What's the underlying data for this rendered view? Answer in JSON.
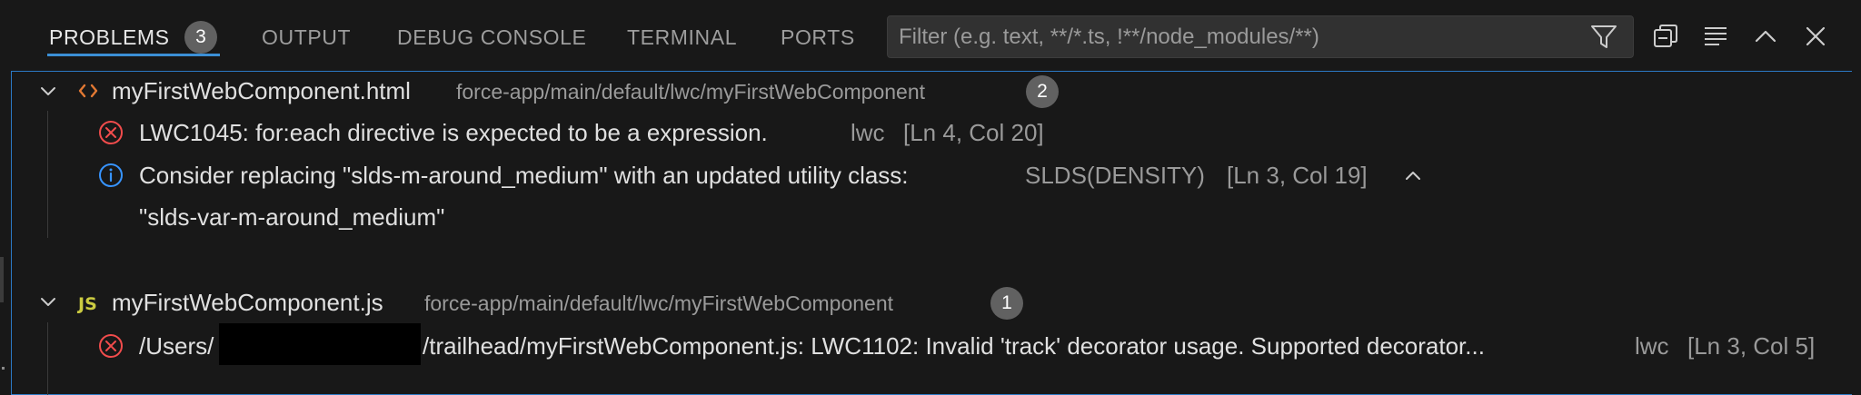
{
  "tabs": [
    {
      "label": "PROBLEMS",
      "badge": "3",
      "active": true
    },
    {
      "label": "OUTPUT"
    },
    {
      "label": "DEBUG CONSOLE"
    },
    {
      "label": "TERMINAL"
    },
    {
      "label": "PORTS"
    }
  ],
  "filter": {
    "placeholder": "Filter (e.g. text, **/*.ts, !**/node_modules/**)",
    "value": ""
  },
  "header_icons": [
    "filter-icon",
    "collapse-all-icon",
    "view-as-list-icon",
    "maximize-panel-icon",
    "close-panel-icon"
  ],
  "files": [
    {
      "icon": "html-file-icon",
      "name": "myFirstWebComponent.html",
      "path": "force-app/main/default/lwc/myFirstWebComponent",
      "count": "2",
      "problems": [
        {
          "severity": "error",
          "icon": "error-icon",
          "message": "LWC1045: for:each directive is expected to be a expression.",
          "source": "lwc",
          "location": "[Ln 4, Col 20]"
        },
        {
          "severity": "info",
          "icon": "info-icon",
          "message": "Consider replacing \"slds-m-around_medium\" with an updated utility class:",
          "message_cont": "\"slds-var-m-around_medium\"",
          "source": "SLDS(DENSITY)",
          "location": "[Ln 3, Col 19]"
        }
      ]
    },
    {
      "icon": "js-file-icon",
      "icon_text": "JS",
      "name": "myFirstWebComponent.js",
      "path": "force-app/main/default/lwc/myFirstWebComponent",
      "count": "1",
      "problems": [
        {
          "severity": "error",
          "icon": "error-icon",
          "message_start": "/Users/",
          "message_end": "/trailhead/myFirstWebComponent.js: LWC1102: Invalid 'track' decorator usage. Supported decorator...",
          "source": "lwc",
          "location": "[Ln 3, Col 5]"
        }
      ]
    }
  ],
  "colors": {
    "background": "#181818",
    "accent": "#3b8fd6",
    "error": "#f14c4c",
    "info": "#3794ff",
    "html_icon": "#e37933",
    "js_icon": "#cbcb41"
  }
}
